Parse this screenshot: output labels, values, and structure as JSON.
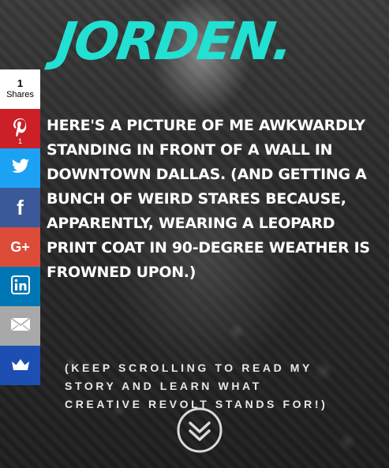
{
  "header": {
    "logo_text": "JORDEN",
    "logo_dot": "."
  },
  "share_bar": {
    "total_count": "1",
    "total_label": "Shares",
    "buttons": [
      {
        "network": "pinterest",
        "icon": "pinterest-icon",
        "glyph": "P",
        "count": "1",
        "color": "#cb2027"
      },
      {
        "network": "twitter",
        "icon": "twitter-icon",
        "glyph": "",
        "count": "",
        "color": "#1da1f2"
      },
      {
        "network": "facebook",
        "icon": "facebook-icon",
        "glyph": "f",
        "count": "",
        "color": "#3b5998"
      },
      {
        "network": "google-plus",
        "icon": "google-plus-icon",
        "glyph": "G+",
        "count": "",
        "color": "#dd4b39"
      },
      {
        "network": "linkedin",
        "icon": "linkedin-icon",
        "glyph": "in",
        "count": "",
        "color": "#0077b5"
      },
      {
        "network": "email",
        "icon": "email-icon",
        "glyph": "",
        "count": "",
        "color": "#a8a8a8"
      },
      {
        "network": "sumome",
        "icon": "crown-icon",
        "glyph": "",
        "count": "",
        "color": "#1d4fb3"
      }
    ]
  },
  "main": {
    "story_text": "HERE'S A PICTURE OF ME AWKWARDLY STANDING IN FRONT OF A WALL IN DOWNTOWN DALLAS. (AND GETTING A BUNCH OF WEIRD STARES BECAUSE, APPARENTLY, WEARING A LEOPARD PRINT COAT IN 90-DEGREE WEATHER IS FROWNED UPON.)",
    "scroll_hint": "(KEEP SCROLLING TO READ MY STORY AND LEARN WHAT CREATIVE REVOLT STANDS FOR!)",
    "scroll_icon": "double-chevron-down-icon"
  },
  "colors": {
    "accent": "#22e0d2",
    "text": "#ffffff"
  }
}
